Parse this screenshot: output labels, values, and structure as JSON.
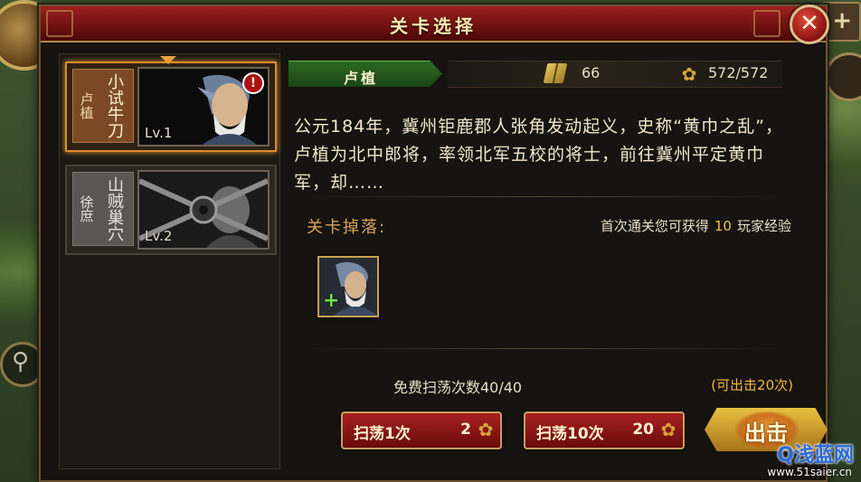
{
  "dialog": {
    "title": "关卡选择",
    "close_label": "✕"
  },
  "stages": [
    {
      "hero": "卢植",
      "stage_name": "小试牛刀",
      "level": "Lv.1",
      "selected": true,
      "has_alert": true,
      "alert": "!"
    },
    {
      "hero": "徐庶",
      "stage_name": "山贼巢穴",
      "level": "Lv.2",
      "selected": false,
      "locked": true
    }
  ],
  "detail": {
    "hero_name": "卢植",
    "book_icon": "book-icon",
    "book_count": "66",
    "wheat_icon": "wheat-icon",
    "stamina": "572/572",
    "story": "公元184年，冀州钜鹿郡人张角发动起义，史称“黄巾之乱”，卢植为北中郎将，率领北军五校的将士，前往冀州平定黄巾军，却……",
    "drops_label": "关卡掉落:",
    "first_clear_prefix": "首次通关您可获得",
    "first_clear_value": "10",
    "first_clear_suffix": "玩家经验",
    "drop_item_badge": "+",
    "free_sweep": "免费扫荡次数40/40",
    "can_attack": "(可出击20次)",
    "sweep1_label": "扫荡1次",
    "sweep1_cost": "2",
    "sweep10_label": "扫荡10次",
    "sweep10_cost": "20",
    "attack_label": "出击"
  },
  "watermark": {
    "logo": "Q浅蓝网",
    "url": "www.51saier.cn"
  },
  "colors": {
    "title_red": "#9c2020",
    "selected_border": "#d98a2c",
    "name_tab_green": "#2d6a22",
    "gold": "#f2c440"
  }
}
